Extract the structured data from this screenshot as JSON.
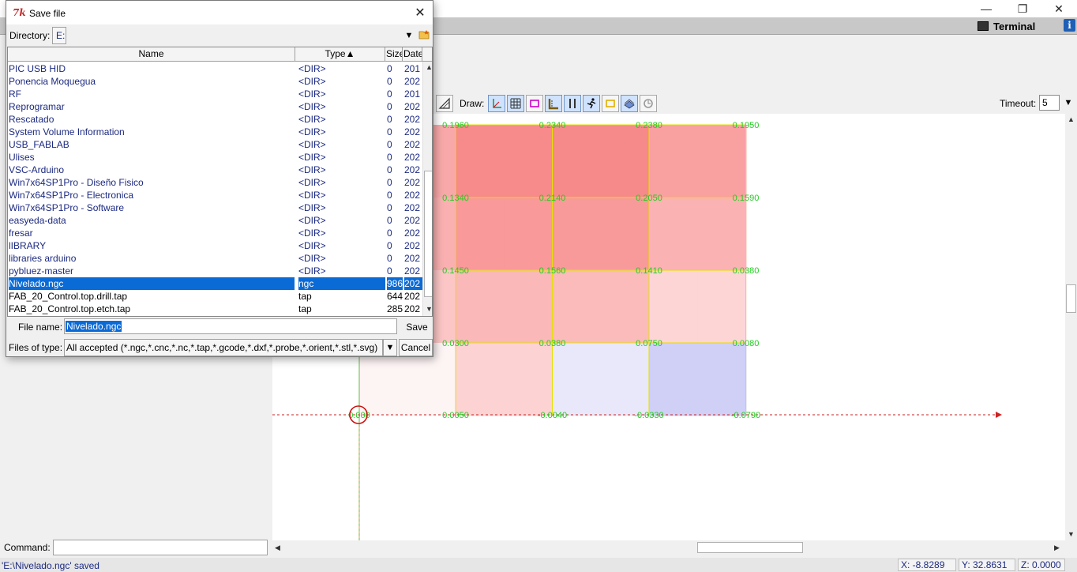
{
  "app": {
    "terminal_label": "Terminal",
    "info_glyph": "i",
    "window_buttons": {
      "minimize": "—",
      "restore": "❐",
      "close": "✕"
    }
  },
  "toolbar": {
    "draw_label": "Draw:",
    "timeout_label": "Timeout:",
    "timeout_value": "5",
    "tools": [
      "line-slope-icon",
      "axis-icon",
      "grid-icon",
      "box-icon",
      "ruler-icon",
      "workpiece-icon",
      "run-icon",
      "rect-icon",
      "layers-icon",
      "refresh-icon"
    ]
  },
  "canvas": {
    "heatmap": {
      "rows": 4,
      "cols": 4,
      "cell_colors": [
        [
          "#f8a8a8",
          "#f78a8a",
          "#f68a8a",
          "#f9a0a0"
        ],
        [
          "#fab0b0",
          "#f99999",
          "#f89a9a",
          "#fbb2b2"
        ],
        [
          "#fcc6c6",
          "#fbb8b8",
          "#fbbbbb",
          "#fdd5d5"
        ],
        [
          "#fdf4f4",
          "#fdd2d2",
          "#e8e8fa",
          "#d0d0f6"
        ]
      ]
    },
    "probe_labels": [
      [
        "0.1960",
        "0.2340",
        "0.2380",
        "0.1950"
      ],
      [
        "0.1340",
        "0.2140",
        "0.2050",
        "0.1590"
      ],
      [
        "0.1450",
        "0.1560",
        "0.1410",
        "0.0380"
      ],
      [
        "0.0300",
        "0.0380",
        "0.0750",
        "0.0080"
      ],
      [
        "0.000",
        "0.0050",
        "-0.0040",
        "-0.0330",
        "-0.0790"
      ]
    ],
    "colors": {
      "grid": "#e6e000",
      "label": "#22cc22",
      "x_axis": "#cc2222",
      "y_axis": "#66bb44",
      "origin": "#cc1111"
    }
  },
  "command": {
    "label": "Command:",
    "value": ""
  },
  "status": {
    "message": "'E:\\Nivelado.ngc' saved",
    "x": "X: -8.8289",
    "y": "Y: 32.8631",
    "z": "Z: 0.0000"
  },
  "dialog": {
    "title": "Save file",
    "tk_icon": "7k",
    "directory_label": "Directory:",
    "directory_value": "E:",
    "columns": {
      "name": "Name",
      "type": "Type▲",
      "size": "Size",
      "date": "Date"
    },
    "files": [
      {
        "name": "PIC USB HID",
        "type": "<DIR>",
        "size": "0",
        "date": "201",
        "dir": true
      },
      {
        "name": "Ponencia Moquegua",
        "type": "<DIR>",
        "size": "0",
        "date": "202",
        "dir": true
      },
      {
        "name": "RF",
        "type": "<DIR>",
        "size": "0",
        "date": "201",
        "dir": true
      },
      {
        "name": "Reprogramar",
        "type": "<DIR>",
        "size": "0",
        "date": "202",
        "dir": true
      },
      {
        "name": "Rescatado",
        "type": "<DIR>",
        "size": "0",
        "date": "202",
        "dir": true
      },
      {
        "name": "System Volume Information",
        "type": "<DIR>",
        "size": "0",
        "date": "202",
        "dir": true
      },
      {
        "name": "USB_FABLAB",
        "type": "<DIR>",
        "size": "0",
        "date": "202",
        "dir": true
      },
      {
        "name": "Ulises",
        "type": "<DIR>",
        "size": "0",
        "date": "202",
        "dir": true
      },
      {
        "name": "VSC-Arduino",
        "type": "<DIR>",
        "size": "0",
        "date": "202",
        "dir": true
      },
      {
        "name": "Win7x64SP1Pro - Diseño Fisico",
        "type": "<DIR>",
        "size": "0",
        "date": "202",
        "dir": true
      },
      {
        "name": "Win7x64SP1Pro - Electronica",
        "type": "<DIR>",
        "size": "0",
        "date": "202",
        "dir": true
      },
      {
        "name": "Win7x64SP1Pro - Software",
        "type": "<DIR>",
        "size": "0",
        "date": "202",
        "dir": true
      },
      {
        "name": "easyeda-data",
        "type": "<DIR>",
        "size": "0",
        "date": "202",
        "dir": true
      },
      {
        "name": "fresar",
        "type": "<DIR>",
        "size": "0",
        "date": "202",
        "dir": true
      },
      {
        "name": "lIBRARY",
        "type": "<DIR>",
        "size": "0",
        "date": "202",
        "dir": true
      },
      {
        "name": "libraries arduino",
        "type": "<DIR>",
        "size": "0",
        "date": "202",
        "dir": true
      },
      {
        "name": "pybluez-master",
        "type": "<DIR>",
        "size": "0",
        "date": "202",
        "dir": true
      },
      {
        "name": "Nivelado.ngc",
        "type": "ngc",
        "size": "986",
        "date": "202",
        "dir": false,
        "selected": true
      },
      {
        "name": "FAB_20_Control.top.drill.tap",
        "type": "tap",
        "size": "644",
        "date": "202",
        "dir": false
      },
      {
        "name": "FAB_20_Control.top.etch.tap",
        "type": "tap",
        "size": "285",
        "date": "202",
        "dir": false
      }
    ],
    "file_name_label": "File name:",
    "file_name_value": "Nivelado.ngc",
    "save_label": "Save",
    "files_of_type_label": "Files of type:",
    "files_of_type_value": "All accepted (*.ngc,*.cnc,*.nc,*.tap,*.gcode,*.dxf,*.probe,*.orient,*.stl,*.svg)",
    "cancel_label": "Cancel"
  }
}
